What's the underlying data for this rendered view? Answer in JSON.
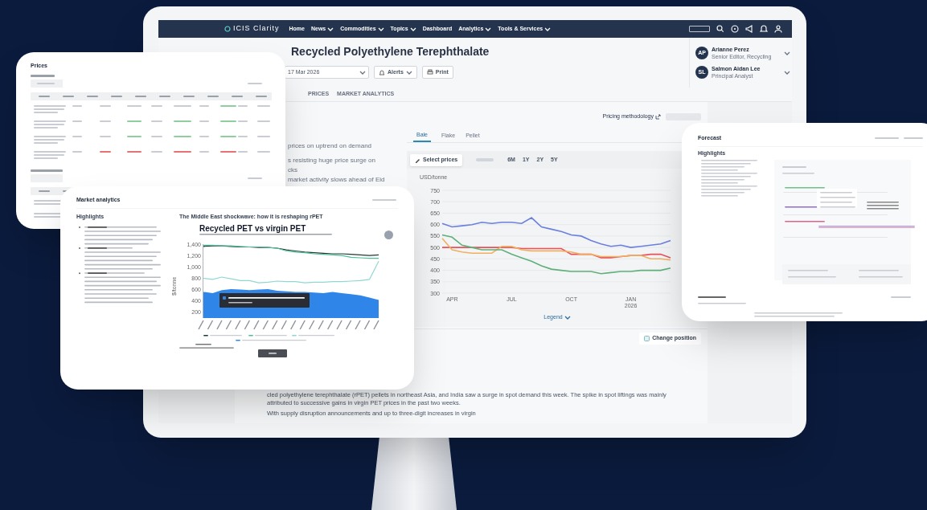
{
  "main_screen": {
    "nav": {
      "logo": "ICIS Clarity",
      "menu": [
        {
          "label": "Home",
          "dropdown": false
        },
        {
          "label": "News",
          "dropdown": true
        },
        {
          "label": "Commodities",
          "dropdown": true
        },
        {
          "label": "Topics",
          "dropdown": true
        },
        {
          "label": "Dashboard",
          "dropdown": false
        },
        {
          "label": "Analytics",
          "dropdown": true
        },
        {
          "label": "Tools & Services",
          "dropdown": true
        }
      ]
    },
    "header": {
      "title": "Recycled Polyethylene Terephthalate",
      "date": "17 Mar 2026",
      "buttons": [
        {
          "kind": "alerts",
          "label": "Alerts"
        },
        {
          "kind": "print",
          "label": "Print"
        }
      ],
      "contacts": [
        {
          "initials": "AP",
          "name": "Arianne Perez",
          "role": "Senior Editor, Recycling"
        },
        {
          "initials": "SL",
          "name": "Salmon Aidan Lee",
          "role": "Principal Analyst"
        }
      ]
    },
    "tabs": [
      {
        "label": "PRICES",
        "selected": false
      },
      {
        "label": "MARKET ANALYTICS",
        "selected": false
      }
    ],
    "section": {
      "link": "Pricing methodology"
    },
    "headlines": [
      "prices on uptrend on demand",
      "s resisting huge price surge on",
      "cks",
      "market activity slows ahead of Eid"
    ],
    "chart_tabs": [
      {
        "label": "Bale",
        "selected": true
      },
      {
        "label": "Flake",
        "selected": false
      },
      {
        "label": "Pellet",
        "selected": false
      }
    ],
    "toolbar": {
      "select_button": "Select prices",
      "ranges": [
        "6M",
        "1Y",
        "2Y",
        "5Y"
      ]
    },
    "chart": {
      "legend": "Legend",
      "chart_data": {
        "type": "line",
        "ylabel": "USD/tonne",
        "grid": true,
        "categories": [
          null,
          "APR",
          null,
          null,
          null,
          null,
          null,
          "JUL",
          null,
          null,
          null,
          null,
          null,
          "OCT",
          null,
          null,
          null,
          null,
          null,
          "JAN 2026",
          null,
          null,
          null,
          null
        ],
        "yticks": [
          300,
          350,
          400,
          450,
          500,
          550,
          600,
          650,
          700,
          750
        ],
        "ylim": [
          300,
          750
        ],
        "series": [
          {
            "color": "#6b7fe0",
            "values": [
              605,
              590,
              595,
              600,
              610,
              605,
              610,
              610,
              605,
              630,
              590,
              580,
              570,
              555,
              550,
              530,
              515,
              505,
              510,
              500,
              505,
              510,
              515,
              530
            ]
          },
          {
            "color": "#e8525a",
            "values": [
              500,
              500,
              500,
              500,
              500,
              500,
              500,
              500,
              495,
              495,
              495,
              495,
              495,
              470,
              470,
              470,
              455,
              455,
              460,
              465,
              465,
              470,
              470,
              455
            ]
          },
          {
            "color": "#f0b060",
            "values": [
              540,
              490,
              480,
              475,
              475,
              475,
              505,
              505,
              490,
              485,
              485,
              485,
              485,
              480,
              470,
              470,
              460,
              460,
              460,
              465,
              465,
              450,
              450,
              445
            ]
          },
          {
            "color": "#5fb07a",
            "values": [
              555,
              545,
              510,
              500,
              490,
              490,
              490,
              470,
              455,
              440,
              420,
              405,
              400,
              395,
              395,
              395,
              385,
              390,
              395,
              395,
              400,
              400,
              400,
              410
            ]
          }
        ]
      }
    },
    "change_button": "Change position",
    "article": [
      "cled polyethylene terephthalate (rPET) pellets in northeast Asia, and India saw a surge in spot demand this week. The spike in spot liftings was mainly attributed to successive gains in virgin PET prices in the past two weeks.",
      "With supply disruption announcements and up to three-digit increases in virgin"
    ]
  },
  "prices_card": {
    "title": "Prices"
  },
  "analytics_card": {
    "title": "Market analytics",
    "heading": "Highlights",
    "chart_heading": "The Middle East shockwave: how it is reshaping rPET",
    "chart": {
      "title": "Recycled PET vs virgin PET",
      "chart_data": {
        "type": "line",
        "ylabel": "$/tonne",
        "yticks": [
          {
            "value": 200,
            "label": "200"
          },
          {
            "value": 400,
            "label": "400"
          },
          {
            "value": 600,
            "label": "600"
          },
          {
            "value": 800,
            "label": "800"
          },
          {
            "value": 1000,
            "label": "1,000"
          },
          {
            "value": 1200,
            "label": "1,200"
          },
          {
            "value": 1400,
            "label": "1,400"
          }
        ],
        "ylim": [
          100,
          1400
        ],
        "series": [
          {
            "type": "line",
            "color": "#1f3b35",
            "values": [
              1360,
              1370,
              1370,
              1360,
              1350,
              1350,
              1340,
              1340,
              1330,
              1300,
              1280,
              1260,
              1250,
              1240,
              1230,
              1230,
              1220,
              1210,
              1200,
              1210
            ]
          },
          {
            "type": "line",
            "color": "#4dbf9a",
            "values": [
              1380,
              1380,
              1370,
              1370,
              1360,
              1350,
              1350,
              1340,
              1330,
              1280,
              1260,
              1250,
              1230,
              1220,
              1210,
              1200,
              1170,
              1160,
              1150,
              1150
            ]
          },
          {
            "type": "line",
            "color": "#8fd8d2",
            "values": [
              800,
              780,
              820,
              790,
              760,
              760,
              720,
              730,
              750,
              740,
              740,
              720,
              730,
              730,
              740,
              740,
              750,
              760,
              780,
              1100
            ]
          },
          {
            "type": "area",
            "color": "#2f86e8",
            "values": [
              560,
              540,
              590,
              610,
              600,
              590,
              600,
              610,
              580,
              570,
              560,
              560,
              550,
              540,
              560,
              540,
              520,
              500,
              460,
              420
            ]
          }
        ]
      }
    }
  },
  "forecast_card": {
    "title": "Forecast",
    "heading": "Highlights"
  }
}
